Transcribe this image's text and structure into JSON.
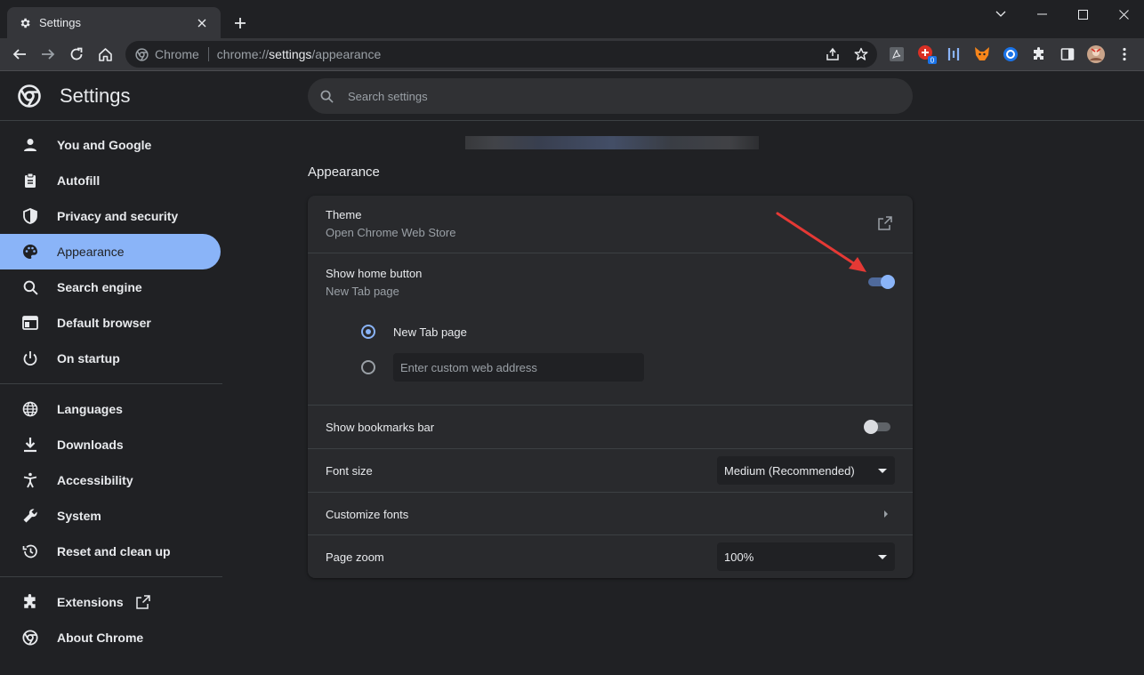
{
  "browser": {
    "tab_title": "Settings",
    "omnibox_chip": "Chrome",
    "url_scheme": "chrome://",
    "url_host": "settings",
    "url_path": "/appearance",
    "extension_badge": "0"
  },
  "header": {
    "title": "Settings",
    "search_placeholder": "Search settings"
  },
  "sidebar": {
    "items": [
      {
        "label": "You and Google",
        "icon": "person-icon"
      },
      {
        "label": "Autofill",
        "icon": "clipboard-icon"
      },
      {
        "label": "Privacy and security",
        "icon": "shield-icon"
      },
      {
        "label": "Appearance",
        "icon": "palette-icon",
        "active": true
      },
      {
        "label": "Search engine",
        "icon": "search-icon"
      },
      {
        "label": "Default browser",
        "icon": "browser-window-icon"
      },
      {
        "label": "On startup",
        "icon": "power-icon"
      },
      {
        "label": "Languages",
        "icon": "globe-icon"
      },
      {
        "label": "Downloads",
        "icon": "download-icon"
      },
      {
        "label": "Accessibility",
        "icon": "accessibility-icon"
      },
      {
        "label": "System",
        "icon": "wrench-icon"
      },
      {
        "label": "Reset and clean up",
        "icon": "history-icon"
      },
      {
        "label": "Extensions",
        "icon": "puzzle-icon"
      },
      {
        "label": "About Chrome",
        "icon": "chrome-icon"
      }
    ]
  },
  "main": {
    "section_title": "Appearance",
    "theme": {
      "label": "Theme",
      "sub": "Open Chrome Web Store"
    },
    "home_button": {
      "label": "Show home button",
      "sub": "New Tab page",
      "enabled": true,
      "option_newtab": "New Tab page",
      "custom_placeholder": "Enter custom web address"
    },
    "bookmarks_bar": {
      "label": "Show bookmarks bar",
      "enabled": false
    },
    "font_size": {
      "label": "Font size",
      "value": "Medium (Recommended)"
    },
    "customize_fonts": {
      "label": "Customize fonts"
    },
    "page_zoom": {
      "label": "Page zoom",
      "value": "100%"
    }
  },
  "colors": {
    "accent": "#8ab4f8",
    "annotation_arrow": "#e53935"
  }
}
